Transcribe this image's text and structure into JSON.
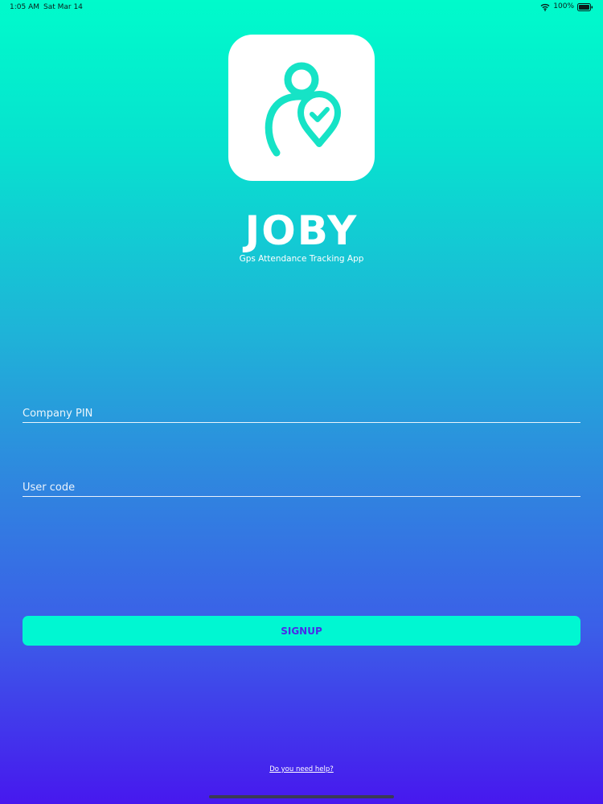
{
  "status_bar": {
    "time": "1:05 AM",
    "date": "Sat Mar 14",
    "battery": "100%",
    "icons": [
      "wifi-icon",
      "battery-icon"
    ]
  },
  "app": {
    "logo_icon": "person-location-check-icon",
    "title": "JOBY",
    "subtitle": "Gps Attendance Tracking App"
  },
  "form": {
    "company_pin": {
      "placeholder": "Company PIN",
      "value": ""
    },
    "user_code": {
      "placeholder": "User code",
      "value": ""
    }
  },
  "signup_label": "SIGNUP",
  "help_link": "Do you need help?",
  "colors": {
    "gradient_top": "#00fbcb",
    "gradient_bottom": "#4718ee",
    "accent_button": "#00f7d2",
    "button_text": "#4a2be8",
    "logo_teal": "#16e3c6"
  }
}
